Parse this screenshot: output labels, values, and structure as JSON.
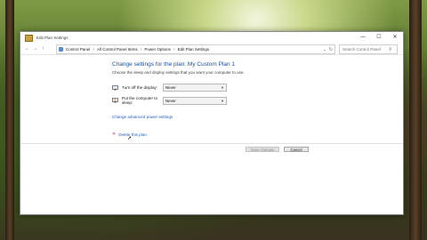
{
  "window": {
    "title": "Edit Plan Settings",
    "controls": {
      "minimize": "—",
      "maximize": "☐",
      "close": "✕"
    }
  },
  "nav": {
    "back": "←",
    "forward": "→",
    "up": "↑",
    "breadcrumbs": [
      "Control Panel",
      "All Control Panel Items",
      "Power Options",
      "Edit Plan Settings"
    ],
    "separator": "›",
    "search_placeholder": "Search Control Panel",
    "refresh": "↻",
    "dropdown": "⌄"
  },
  "main": {
    "heading": "Change settings for the plan: My Custom Plan 1",
    "subtext": "Choose the sleep and display settings that you want your computer to use.",
    "settings": [
      {
        "label": "Turn off the display:",
        "value": "Never",
        "icon": "monitor-icon"
      },
      {
        "label": "Put the computer to sleep:",
        "value": "Never",
        "icon": "moon-sleep-icon"
      }
    ],
    "advanced_link": "Change advanced power settings",
    "restore_link": "Delete this plan"
  },
  "footer": {
    "save_label": "Save changes",
    "cancel_label": "Cancel"
  },
  "colors": {
    "heading": "#1e4fa0",
    "link": "#1e5fc8",
    "delete_x": "#d04040"
  }
}
